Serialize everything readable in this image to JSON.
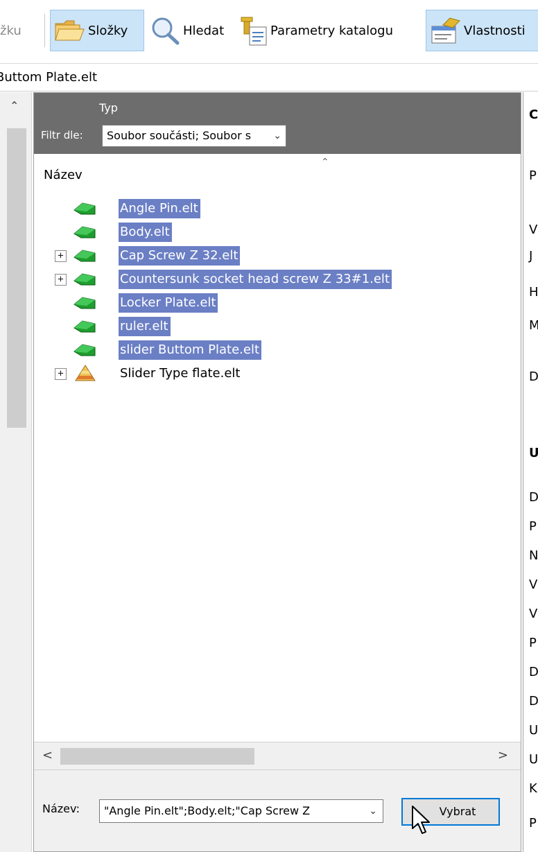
{
  "toolbar": {
    "items": [
      {
        "label": "žku"
      },
      {
        "label": "Složky"
      },
      {
        "label": "Hledat"
      },
      {
        "label": "Parametry katalogu"
      },
      {
        "label": "Vlastnosti"
      }
    ]
  },
  "path": "Buttom Plate.elt",
  "filter": {
    "type_label": "Typ",
    "label": "Filtr dle:",
    "value": "Soubor součásti; Soubor s"
  },
  "tree": {
    "column_header": "Název",
    "items": [
      {
        "label": "Angle Pin.elt"
      },
      {
        "label": "Body.elt"
      },
      {
        "label": "Cap Screw Z 32.elt",
        "expander": "+"
      },
      {
        "label": "Countersunk socket head screw Z 33#1.elt",
        "expander": "+"
      },
      {
        "label": "Locker Plate.elt"
      },
      {
        "label": "ruler.elt"
      },
      {
        "label": "slider Buttom Plate.elt"
      },
      {
        "label": "Slider Type flate.elt",
        "expander": "+"
      }
    ]
  },
  "bottom": {
    "name_label": "Název:",
    "name_value": "\"Angle Pin.elt\";Body.elt;\"Cap Screw Z",
    "select_button": "Vybrat"
  },
  "right_pane": {
    "letters": [
      "C",
      "P",
      "V",
      "J",
      "H",
      "M",
      "D",
      "U",
      "D",
      "P",
      "N",
      "V",
      "V",
      "P",
      "D",
      "D",
      "U",
      "U",
      "K",
      "P"
    ]
  },
  "colors": {
    "selection": "#6b7fc5",
    "filter_bar": "#6d6d6d",
    "pressed_button": "#cce4f7",
    "default_button_border": "#0078d7"
  }
}
